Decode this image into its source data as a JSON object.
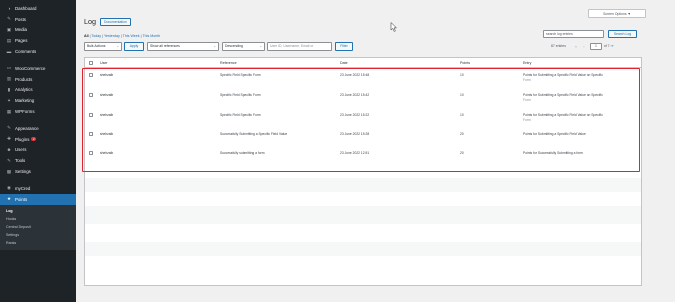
{
  "sidebar": {
    "items": [
      {
        "label": "Dashboard",
        "icon": "dashboard-icon",
        "glyph": "◑"
      },
      {
        "label": "Posts",
        "icon": "pin-icon",
        "glyph": "✎"
      },
      {
        "label": "Media",
        "icon": "media-icon",
        "glyph": "▣"
      },
      {
        "label": "Pages",
        "icon": "pages-icon",
        "glyph": "▤"
      },
      {
        "label": "Comments",
        "icon": "comments-icon",
        "glyph": "▬"
      },
      {
        "label": "WooCommerce",
        "icon": "woocommerce-icon",
        "glyph": "▭"
      },
      {
        "label": "Products",
        "icon": "products-icon",
        "glyph": "▥"
      },
      {
        "label": "Analytics",
        "icon": "analytics-icon",
        "glyph": "▮"
      },
      {
        "label": "Marketing",
        "icon": "marketing-icon",
        "glyph": "✦"
      },
      {
        "label": "WPForms",
        "icon": "wpforms-icon",
        "glyph": "▦"
      },
      {
        "label": "Appearance",
        "icon": "appearance-icon",
        "glyph": "✎"
      },
      {
        "label": "Plugins",
        "icon": "plugins-icon",
        "glyph": "✚",
        "badge": "2"
      },
      {
        "label": "Users",
        "icon": "users-icon",
        "glyph": "☻"
      },
      {
        "label": "Tools",
        "icon": "tools-icon",
        "glyph": "✎"
      },
      {
        "label": "Settings",
        "icon": "settings-icon",
        "glyph": "▩"
      },
      {
        "label": "myCred",
        "icon": "mycred-icon",
        "glyph": "◉"
      },
      {
        "label": "Points",
        "icon": "star-icon",
        "glyph": "★",
        "active": true
      }
    ],
    "submenu": [
      {
        "label": "Log",
        "current": true
      },
      {
        "label": "Hooks"
      },
      {
        "label": "Central Deposit"
      },
      {
        "label": "Settings"
      },
      {
        "label": "Ranks"
      }
    ]
  },
  "header": {
    "title": "Log",
    "documentation_label": "Documentation",
    "screen_options_label": "Screen Options ▼"
  },
  "filters": {
    "all": "All",
    "today": "Today",
    "yesterday": "Yesterday",
    "this_week": "This Week",
    "this_month": "This Month",
    "sep": " | "
  },
  "search": {
    "placeholder": "search log entries",
    "button_label": "Search Log"
  },
  "toolbar": {
    "bulk_actions": "Bulk Actions",
    "apply": "Apply",
    "references": "Show all references",
    "order": "Descending",
    "user_placeholder": "User ID, Username, Email or",
    "filter": "Filter"
  },
  "pagination": {
    "count": "87 entries",
    "first": "«",
    "prev": "‹",
    "page": "1",
    "of_label": "of 7",
    "next_link": "›»"
  },
  "table": {
    "columns": [
      "User",
      "Reference",
      "Date",
      "Points",
      "Entry"
    ],
    "rows": [
      {
        "user": "shehzaib",
        "reference": "Specific Field Specific Form",
        "date": "23 June 2022 15:48",
        "points": "10",
        "entry": "Points for Submitting a Specific Field Value on Specific",
        "entry2": "Form"
      },
      {
        "user": "shehzaib",
        "reference": "Specific Field Specific Form",
        "date": "23 June 2022 15:42",
        "points": "10",
        "entry": "Points for Submitting a Specific Field Value on Specific",
        "entry2": "Form"
      },
      {
        "user": "shehzaib",
        "reference": "Specific Field Specific Form",
        "date": "23 June 2022 15:22",
        "points": "10",
        "entry": "Points for Submitting a Specific Field Value on Specific",
        "entry2": "Form"
      },
      {
        "user": "shehzaib",
        "reference": "Successfully Submitting a Specific Field Value",
        "date": "23 June 2022 15:28",
        "points": "20",
        "entry": "Points for Submitting a Specific Field Value",
        "entry2": ""
      },
      {
        "user": "shehzaib",
        "reference": "Successfully submitting a form",
        "date": "23 June 2022 12:51",
        "points": "20",
        "entry": "Points for Successfully Submitting a form",
        "entry2": ""
      }
    ]
  },
  "colors": {
    "sidebar_bg": "#1d2327",
    "accent": "#2271b1",
    "highlight": "#e0232e"
  }
}
